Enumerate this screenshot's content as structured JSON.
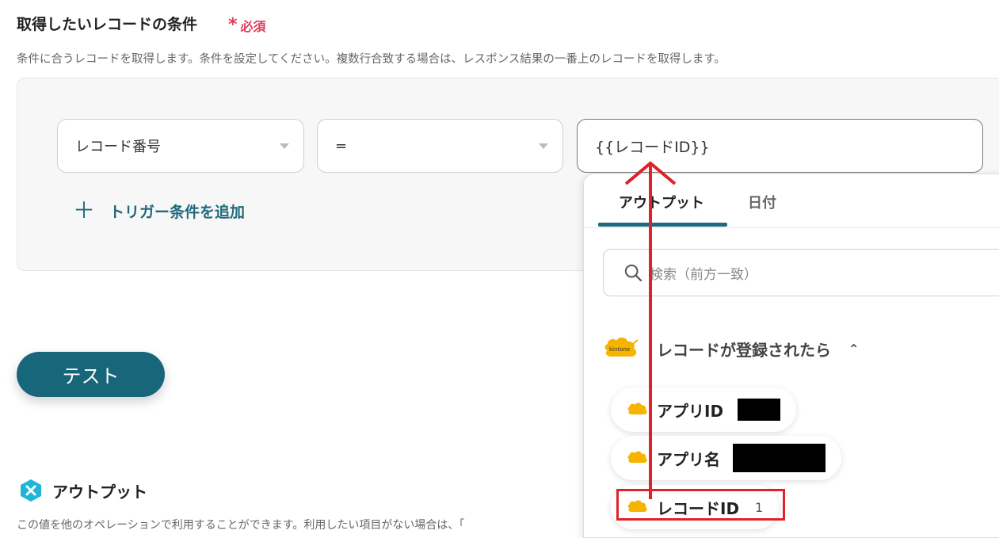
{
  "section": {
    "title": "取得したいレコードの条件",
    "required_star": "*",
    "required_label": "必須",
    "description": "条件に合うレコードを取得します。条件を設定してください。複数行合致する場合は、レスポンス結果の一番上のレコードを取得します。"
  },
  "condition": {
    "field_select": "レコード番号",
    "operator_select": "=",
    "value": "{{レコードID}}",
    "add_label": "トリガー条件を追加",
    "add_icon": "plus-icon"
  },
  "test_button": "テスト",
  "output_section": {
    "title": "アウトプット",
    "icon": "x-hexagon-icon",
    "description": "この値を他のオペレーションで利用することができます。利用したい項目がない場合は、「"
  },
  "popup": {
    "tabs": [
      {
        "label": "アウトプット",
        "active": true
      },
      {
        "label": "日付",
        "active": false
      }
    ],
    "search_placeholder": "検索（前方一致）",
    "group": {
      "label": "レコードが登録されたら",
      "logo_text": "kintone",
      "expanded": true
    },
    "items": [
      {
        "label": "アプリID",
        "value": "",
        "redacted": true
      },
      {
        "label": "アプリ名",
        "value": "",
        "redacted": true
      },
      {
        "label": "レコードID",
        "value": "1",
        "redacted": false,
        "highlighted": true
      }
    ]
  },
  "colors": {
    "accent": "#1e6a7e",
    "required": "#e0405a",
    "annotation": "#e0202a",
    "kintone": "#f6b400"
  }
}
